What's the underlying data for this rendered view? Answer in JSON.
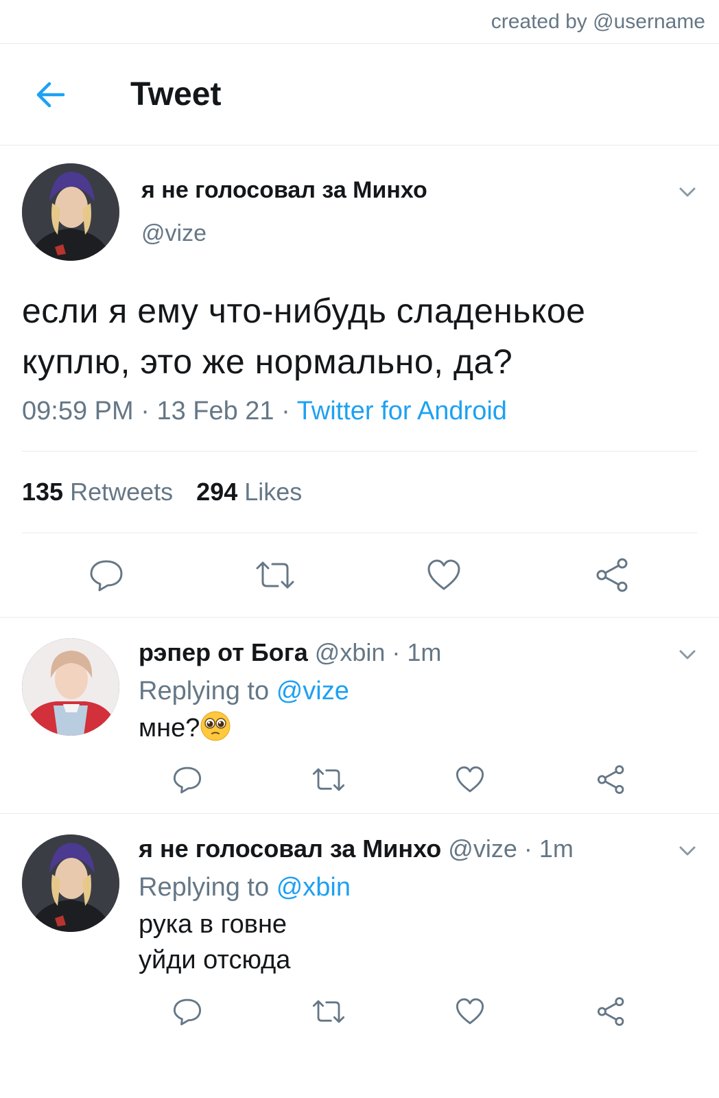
{
  "credit": "created by @username",
  "header": {
    "title": "Tweet",
    "back_icon": "arrow-left-icon"
  },
  "colors": {
    "link": "#1da1f2",
    "muted": "#657786",
    "text": "#14171a",
    "divider": "#e6ecf0"
  },
  "main_tweet": {
    "name": "я не голосовал за Минхо",
    "handle": "@vize",
    "text_line1": "если я ему что-нибудь сладенькое",
    "text_line2": "куплю, это же нормально, да?",
    "time": "09:59 PM",
    "date": "13 Feb 21",
    "source": "Twitter for Android",
    "retweets_count": "135",
    "retweets_label": "Retweets",
    "likes_count": "294",
    "likes_label": "Likes"
  },
  "replies": [
    {
      "name": "рэпер от Бога",
      "handle": "@xbin",
      "time": "1m",
      "replying_label": "Replying to",
      "replying_to": "@vize",
      "text_line1": "мне?",
      "emoji": "pleading-face"
    },
    {
      "name": "я не голосовал за Минхо",
      "handle": "@vize",
      "time": "1m",
      "replying_label": "Replying to",
      "replying_to": "@xbin",
      "text_line1": "рука в говне",
      "text_line2": "уйди отсюда"
    }
  ]
}
